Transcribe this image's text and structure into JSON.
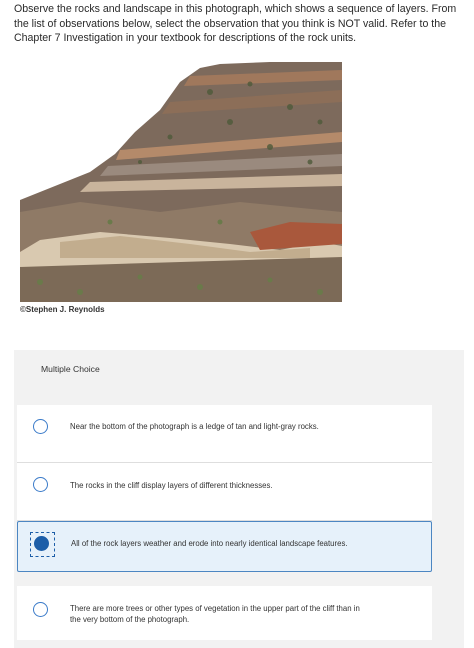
{
  "question": {
    "prompt": "Observe the rocks and landscape in this photograph, which shows a sequence of layers. From the list of observations below, select the observation that you think is NOT valid. Refer to the Chapter 7 Investigation in your textbook for descriptions of the rock units."
  },
  "figure": {
    "credit": "©Stephen J. Reynolds"
  },
  "multiple_choice": {
    "header": "Multiple Choice",
    "options": [
      {
        "label": "Near the bottom of the photograph is a ledge of tan and light-gray rocks.",
        "selected": false
      },
      {
        "label": "The rocks in the cliff display layers of different thicknesses.",
        "selected": false
      },
      {
        "label": "All of the rock layers weather and erode into nearly identical landscape features.",
        "selected": true
      },
      {
        "label": "There are more trees or other types of vegetation in the upper part of the cliff than in the very bottom of the photograph.",
        "selected": false
      }
    ]
  },
  "colors": {
    "accent": "#1c5ea8",
    "selected_bg": "#e6f1fa",
    "panel_bg": "#f2f2f2"
  }
}
